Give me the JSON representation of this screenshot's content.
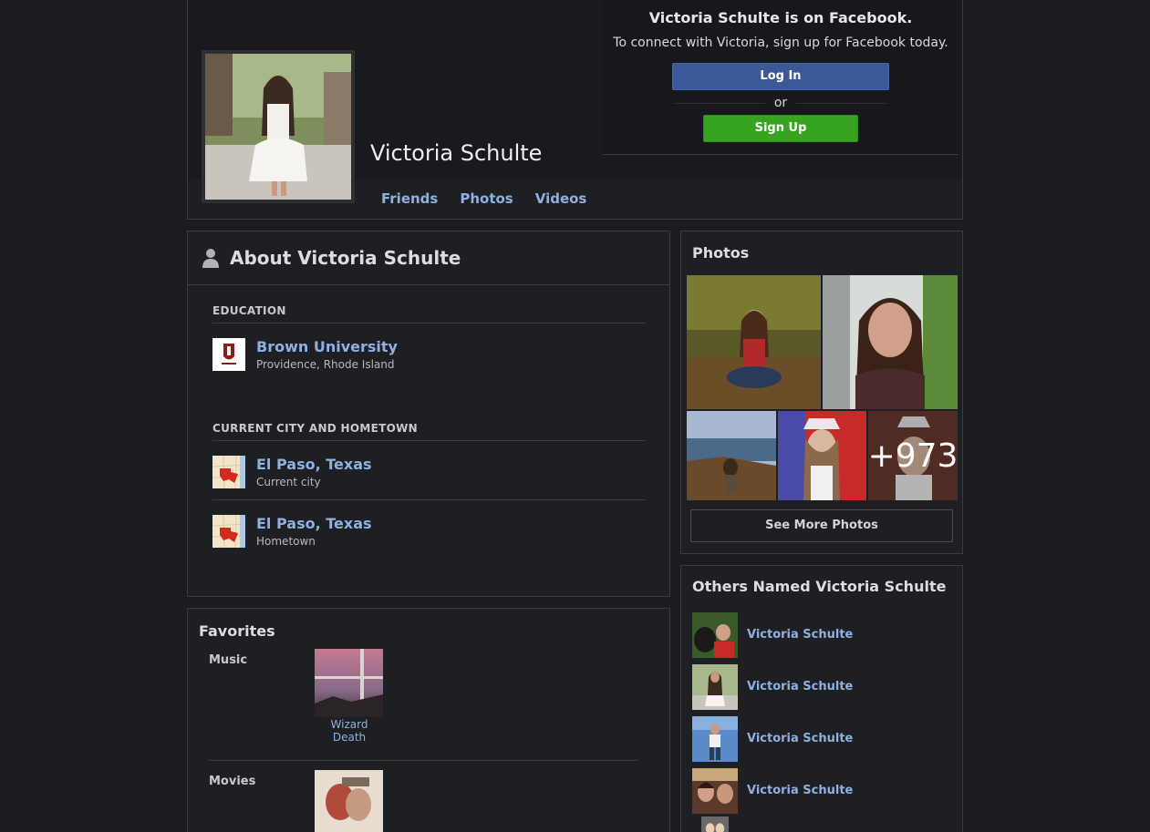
{
  "header": {
    "name": "Victoria Schulte",
    "nav": [
      "Friends",
      "Photos",
      "Videos"
    ]
  },
  "signup": {
    "title": "Victoria Schulte is on Facebook.",
    "subtitle": "To connect with Victoria, sign up for Facebook today.",
    "login_label": "Log In",
    "or_label": "or",
    "signup_label": "Sign Up"
  },
  "about": {
    "title": "About Victoria Schulte",
    "education_title": "EDUCATION",
    "education": [
      {
        "name": "Brown University",
        "sub": "Providence, Rhode Island"
      }
    ],
    "city_title": "CURRENT CITY AND HOMETOWN",
    "cities": [
      {
        "name": "El Paso, Texas",
        "sub": "Current city"
      },
      {
        "name": "El Paso, Texas",
        "sub": "Hometown"
      }
    ]
  },
  "favorites": {
    "title": "Favorites",
    "music_label": "Music",
    "music_item": "Wizard Death",
    "movies_label": "Movies"
  },
  "photos": {
    "title": "Photos",
    "more_count": "+973",
    "see_more_label": "See More Photos"
  },
  "others": {
    "title": "Others Named Victoria Schulte",
    "people": [
      "Victoria Schulte",
      "Victoria Schulte",
      "Victoria Schulte",
      "Victoria Schulte"
    ]
  },
  "colors": {
    "link": "#8fb0e0",
    "login_button": "#3b5998",
    "signup_button": "#36a420",
    "background": "#1b1c1f"
  }
}
